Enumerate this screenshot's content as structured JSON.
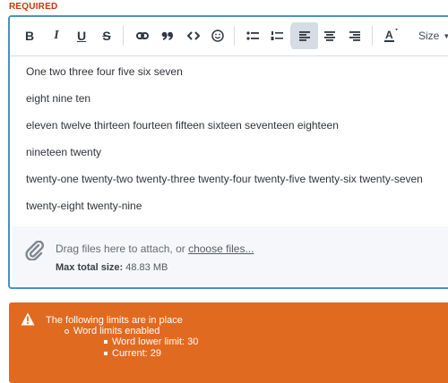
{
  "field": {
    "required_label": "REQUIRED"
  },
  "toolbar": {
    "bold_label": "B",
    "italic_label": "I",
    "underline_label": "U",
    "strike_label": "S",
    "size_label": "Size",
    "active_button": "align-left",
    "icons": [
      "bold-icon",
      "italic-icon",
      "underline-icon",
      "strikethrough-icon",
      "link-icon",
      "quote-icon",
      "code-icon",
      "emoji-icon",
      "bullet-list-icon",
      "numbered-list-icon",
      "align-left-icon",
      "align-center-icon",
      "align-right-icon",
      "text-color-icon",
      "chevron-down-icon"
    ]
  },
  "content": {
    "paragraphs": [
      "One two three four five six seven",
      "eight nine ten",
      "eleven twelve thirteen fourteen fifteen sixteen seventeen eighteen",
      "nineteen twenty",
      "twenty-one twenty-two twenty-three twenty-four twenty-five twenty-six twenty-seven",
      "twenty-eight twenty-nine"
    ]
  },
  "attach": {
    "prompt": "Drag files here to attach, or ",
    "link": "choose files...",
    "size_label": "Max total size:",
    "size_value": "48.83 MB",
    "icon": "paperclip-icon"
  },
  "warning": {
    "title": "The following limits are in place",
    "item": "Word limits enabled",
    "sub_items": [
      "Word lower limit: 30",
      "Current: 29"
    ],
    "color": "#e16a21",
    "icon": "warning-triangle-icon"
  }
}
